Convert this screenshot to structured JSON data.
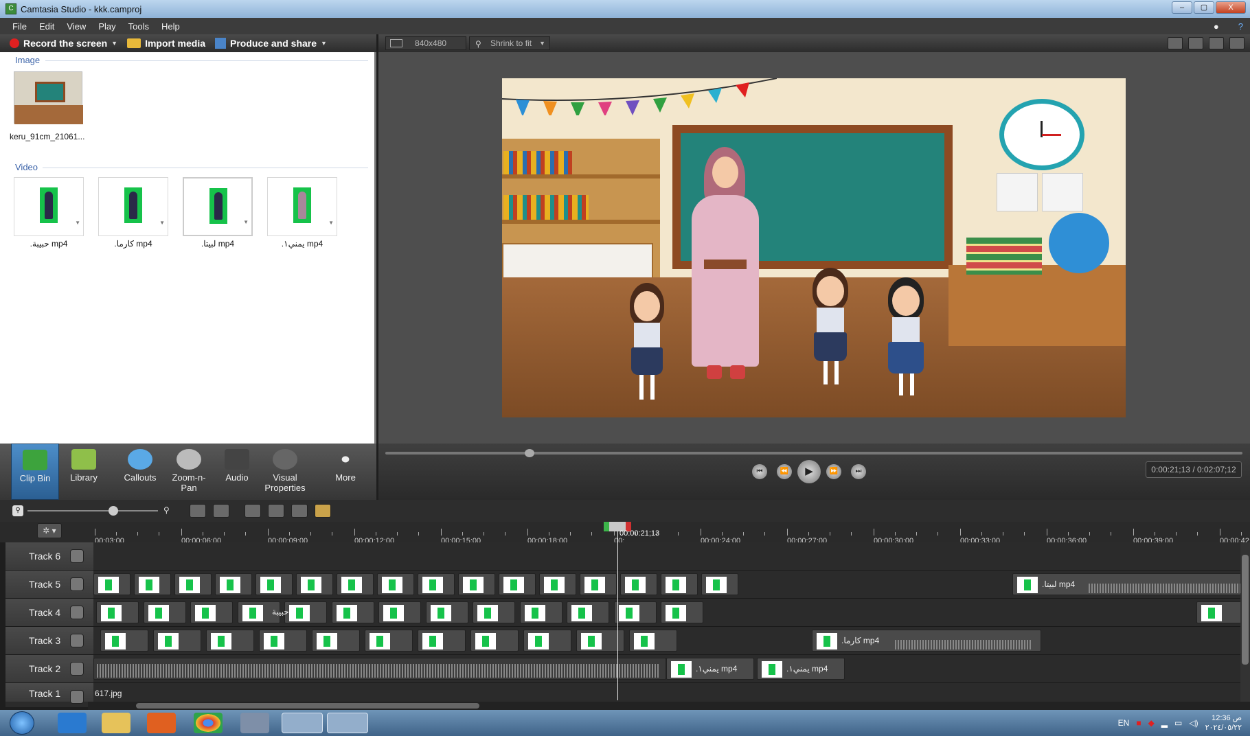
{
  "window": {
    "title": "Camtasia Studio - kkk.camproj",
    "controls": [
      "–",
      "▢",
      "X"
    ]
  },
  "menu": [
    "File",
    "Edit",
    "View",
    "Play",
    "Tools",
    "Help"
  ],
  "toolbar": {
    "record": "Record the screen",
    "import": "Import media",
    "produce": "Produce and share"
  },
  "clip_bin": {
    "image_section": "Image",
    "image_item": "keru_91cm_21061...",
    "video_section": "Video",
    "videos": [
      ".حبيبة mp4",
      ".كارما mp4",
      ".لبيتا mp4",
      ".يمني١ mp4"
    ]
  },
  "preview": {
    "dimensions": "840x480",
    "zoom": "Shrink to fit"
  },
  "tabs": [
    {
      "label": "Clip Bin",
      "active": true
    },
    {
      "label": "Library"
    },
    {
      "label": "Callouts"
    },
    {
      "label": "Zoom-n-\nPan"
    },
    {
      "label": "Audio"
    },
    {
      "label": "Visual\nProperties"
    },
    {
      "label": "More"
    }
  ],
  "player": {
    "time": "0:00:21;13 / 0:02:07;12",
    "progress": 0.168
  },
  "timeline": {
    "ticks": [
      "00:03;00",
      "00:00:06;00",
      "00:00:09;00",
      "00:00:12;00",
      "00:00:15;00",
      "00:00:18;00",
      "00:",
      "00:00:24;00",
      "00:00:27;00",
      "00:00:30;00",
      "00:00:33;00",
      "00:00:36;00",
      "00:00:39;00",
      "00:00:42;0"
    ],
    "playhead_time": "00:00:21;13",
    "tracks": [
      {
        "name": "Track 6"
      },
      {
        "name": "Track 5",
        "clip_label": ".لبيتا mp4"
      },
      {
        "name": "Track 4",
        "clip_label": "حبيبة"
      },
      {
        "name": "Track 3",
        "clip_label": ".كارما mp4"
      },
      {
        "name": "Track 2",
        "clip_labels": [
          ".يمني١ mp4",
          ".يمني١ mp4"
        ]
      },
      {
        "name": "Track 1",
        "clip_label": "617.jpg"
      }
    ]
  },
  "taskbar": {
    "lang": "EN",
    "time": "12:36 ص",
    "date": "٢٠٢٤/٠٥/٢٢"
  },
  "colors": {
    "accent": "#2b5f93",
    "record": "#e02020",
    "greenscreen": "#16c24a",
    "board": "#23837a"
  }
}
